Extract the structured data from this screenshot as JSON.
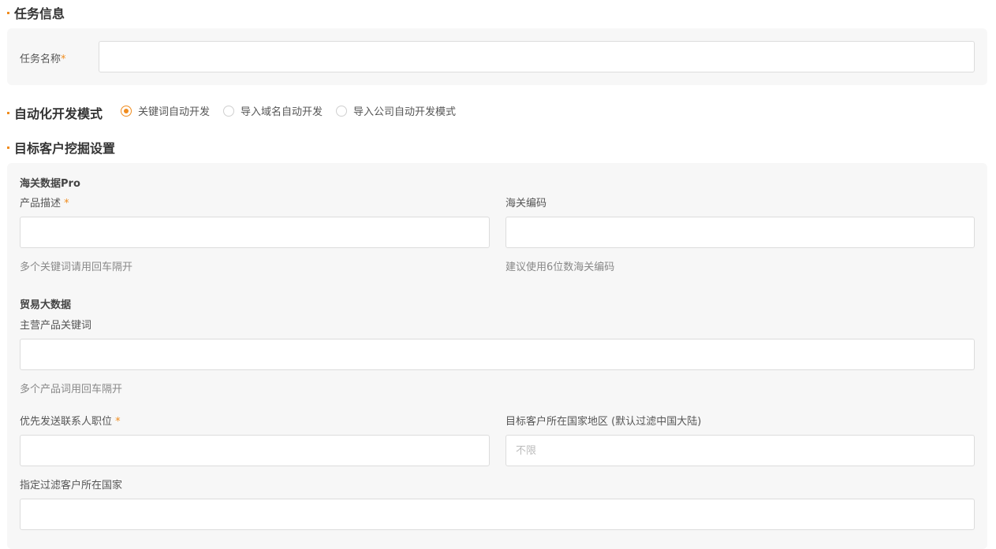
{
  "task_info": {
    "title": "任务信息",
    "name_label": "任务名称",
    "required_mark": "*",
    "name_value": ""
  },
  "mode": {
    "title": "自动化开发模式",
    "options": [
      {
        "label": "关键词自动开发",
        "checked": true
      },
      {
        "label": "导入域名自动开发",
        "checked": false
      },
      {
        "label": "导入公司自动开发模式",
        "checked": false
      }
    ]
  },
  "target": {
    "title": "目标客户挖掘设置",
    "customs": {
      "title": "海关数据Pro",
      "product_label": "产品描述",
      "product_required": "*",
      "product_hint": "多个关键词请用回车隔开",
      "hs_label": "海关编码",
      "hs_hint": "建议使用6位数海关编码"
    },
    "trade": {
      "title": "贸易大数据",
      "keywords_label": "主营产品关键词",
      "keywords_hint": "多个产品词用回车隔开"
    },
    "contact_label": "优先发送联系人职位",
    "contact_required": "*",
    "region_label": "目标客户所在国家地区 (默认过滤中国大陆)",
    "region_placeholder": "不限",
    "filter_label": "指定过滤客户所在国家"
  },
  "colors": {
    "accent": "#f08c1e",
    "panel_bg": "#f7f7f7"
  }
}
